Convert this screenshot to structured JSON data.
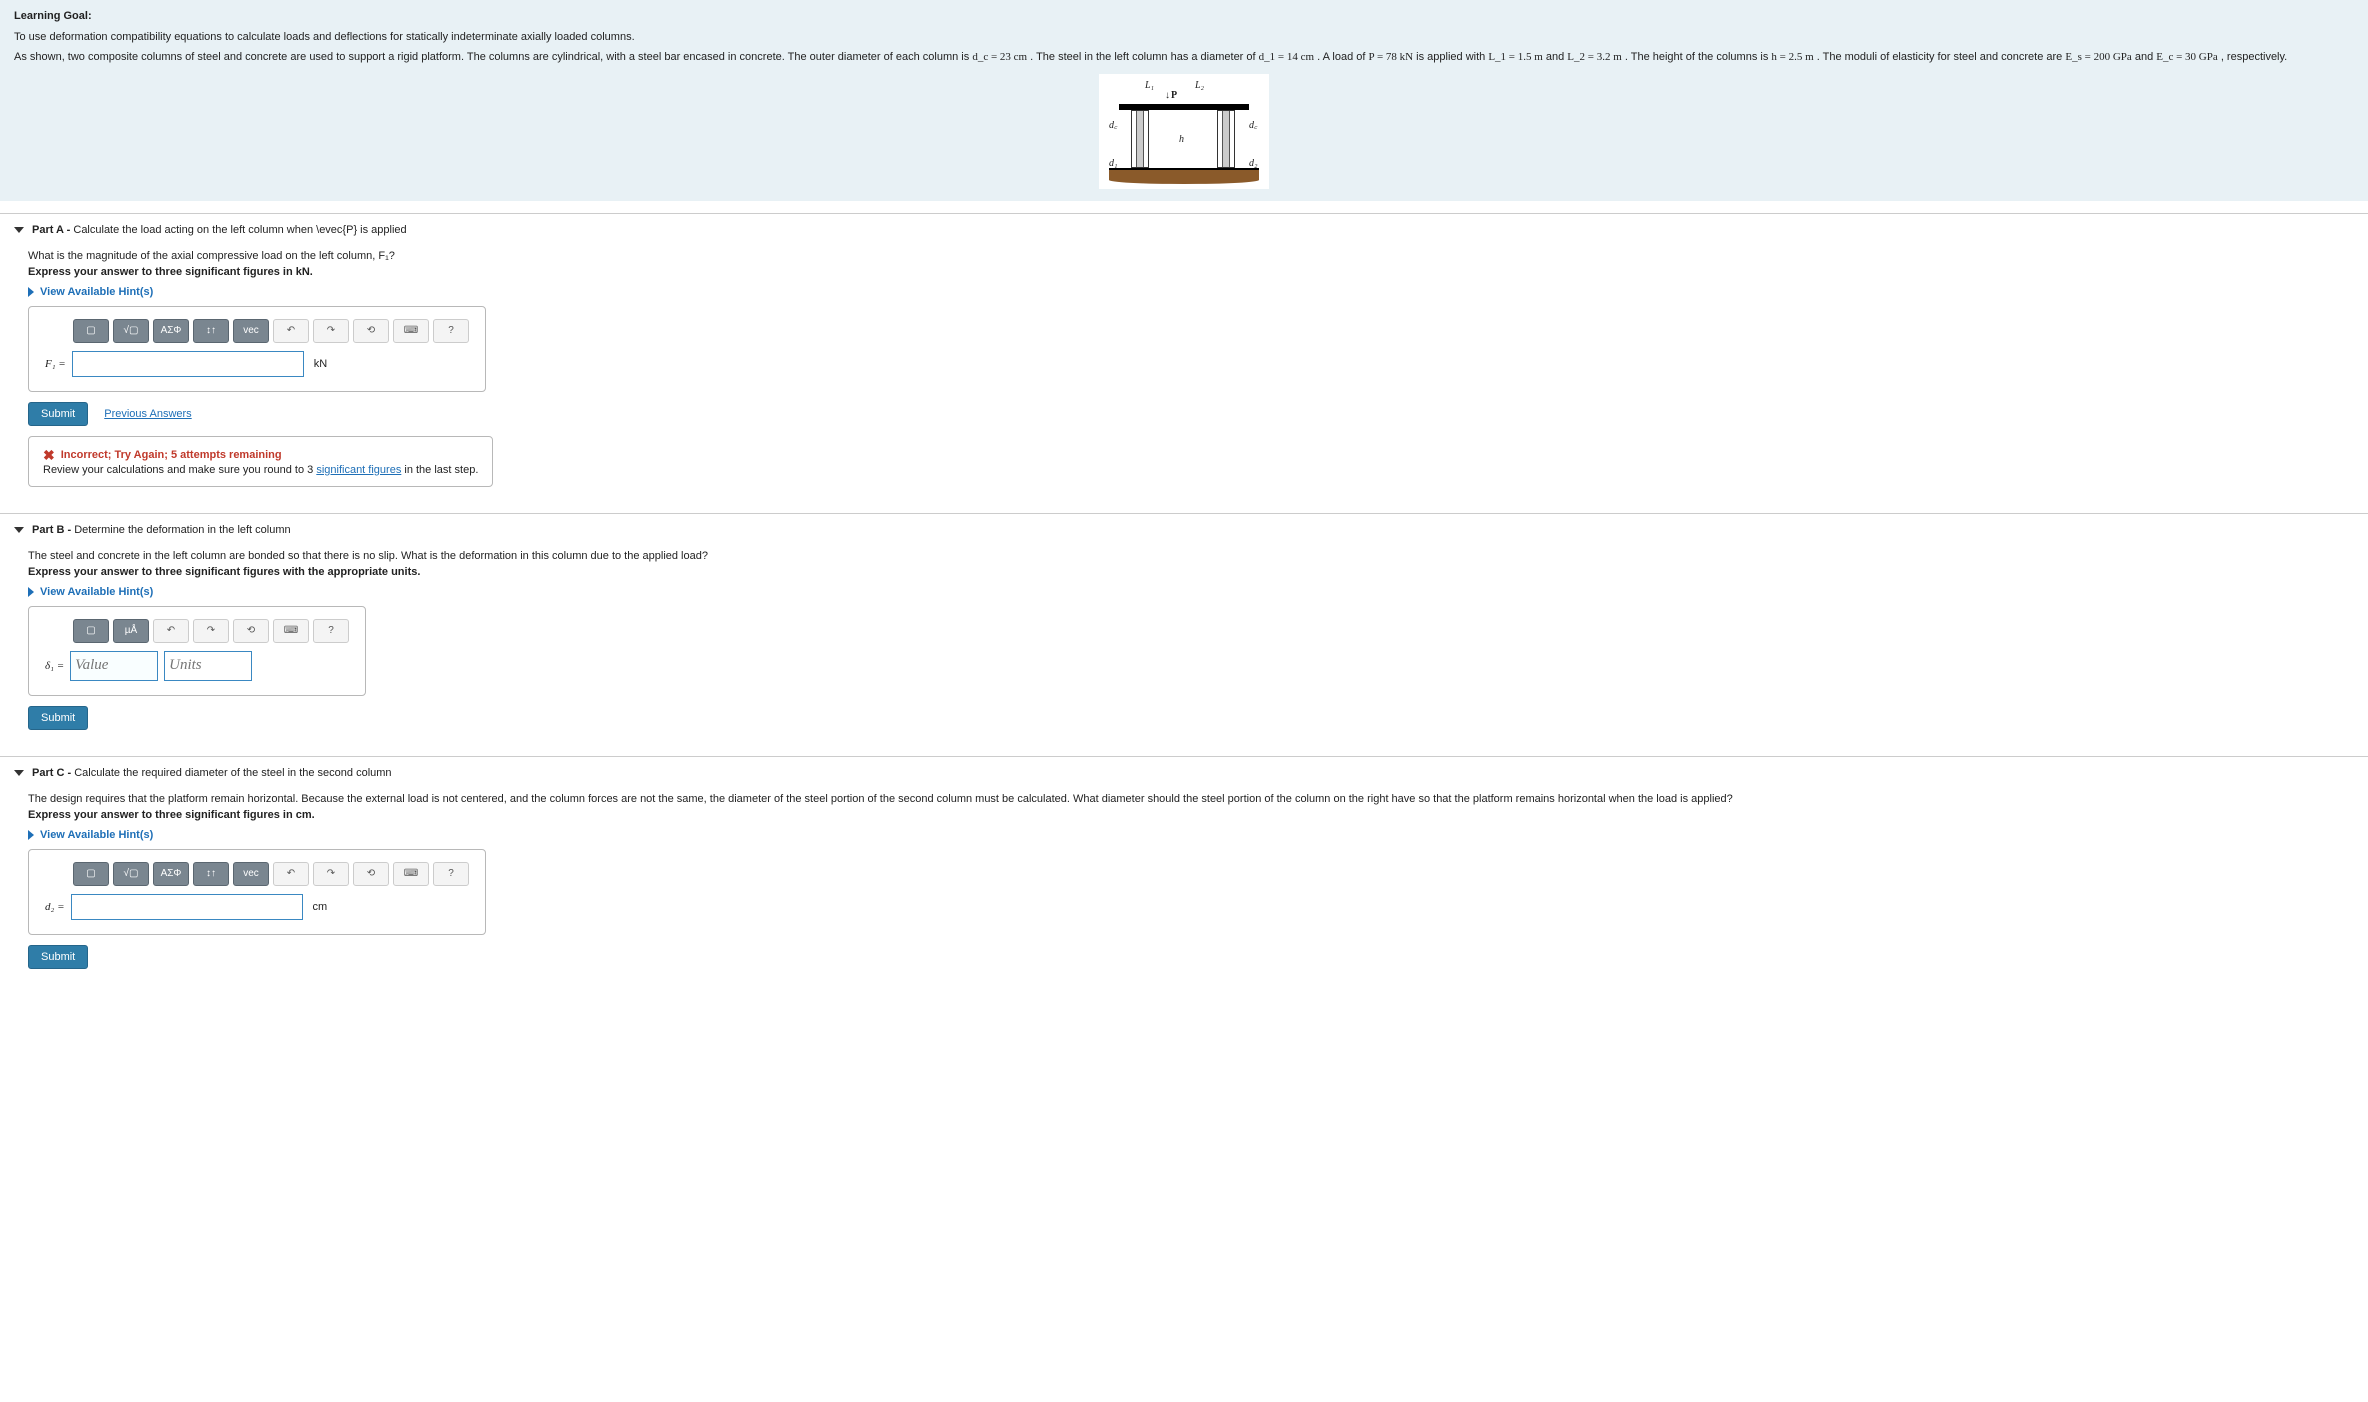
{
  "intro": {
    "goal_label": "Learning Goal:",
    "goal": "To use deformation compatibility equations to calculate loads and deflections for statically indeterminate axially loaded columns.",
    "desc_pre": "As shown, two composite columns of steel and concrete are used to support a rigid platform. The columns are cylindrical, with a steel bar encased in concrete. The outer diameter of each column is ",
    "dc": "d_c = 23 cm",
    "desc_1": " . The steel in the left column has a diameter of ",
    "d1": "d_1 = 14 cm",
    "desc_2": " . A load of ",
    "P": "P = 78 kN",
    "desc_3": " is applied with ",
    "L1": "L_1 = 1.5 m",
    "and": " and ",
    "L2": "L_2 = 3.2 m",
    "desc_4": " . The height of the columns is ",
    "h": "h = 2.5 m",
    "desc_5": " . The moduli of elasticity for steel and concrete are ",
    "Es": "E_s = 200 GPa",
    "Ec": "E_c = 30 GPa",
    "desc_end": " , respectively."
  },
  "figure": {
    "L1": "L₁",
    "L2": "L₂",
    "P": "P",
    "dc": "d꜀",
    "d1": "d₁",
    "d2": "d₂",
    "h": "h"
  },
  "hint_label": "View Available Hint(s)",
  "toolbar": {
    "template": "▢",
    "sqrt": "√▢",
    "greek": "ΑΣΦ",
    "arrows": "↕↑",
    "vec": "vec",
    "undo": "↶",
    "redo": "↷",
    "reset": "⟲",
    "keyboard": "⌨",
    "help": "?",
    "units": "µÅ"
  },
  "submit": "Submit",
  "prev_answers": "Previous Answers",
  "partA": {
    "header_label": "Part A -",
    "header": "Calculate the load acting on the left column when \\evec{P} is applied",
    "q": "What is the magnitude of the axial compressive load on the left column, F₁?",
    "instruct": "Express your answer to three significant figures in kN.",
    "var": "F₁ =",
    "unit": "kN",
    "fb_title": "Incorrect; Try Again; 5 attempts remaining",
    "fb_body_pre": "Review your calculations and make sure you round to 3 ",
    "fb_link": "significant figures",
    "fb_body_post": " in the last step."
  },
  "partB": {
    "header_label": "Part B -",
    "header": "Determine the deformation in the left column",
    "q": "The steel and concrete in the left column are bonded so that there is no slip. What is the deformation in this column due to the applied load?",
    "instruct": "Express your answer to three significant figures with the appropriate units.",
    "var": "δ₁ =",
    "value_ph": "Value",
    "units_ph": "Units"
  },
  "partC": {
    "header_label": "Part C -",
    "header": "Calculate the required diameter of the steel in the second column",
    "q": "The design requires that the platform remain horizontal. Because the external load is not centered, and the column forces are not the same, the diameter of the steel portion of the second column must be calculated. What diameter should the steel portion of the column on the right have so that the platform remains horizontal when the load is applied?",
    "instruct": "Express your answer to three significant figures in cm.",
    "var": "d₂ =",
    "unit": "cm"
  }
}
